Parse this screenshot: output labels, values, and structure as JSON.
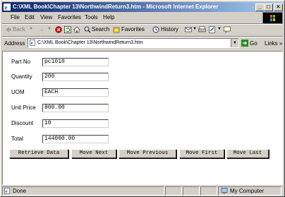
{
  "window": {
    "title": "C:\\XML Book\\Chapter 13\\NorthwindReturn3.htm - Microsoft Internet Explorer",
    "controls": {
      "minimize": "_",
      "maximize": "□",
      "close": "×"
    }
  },
  "menu": [
    "File",
    "Edit",
    "View",
    "Favorites",
    "Tools",
    "Help"
  ],
  "toolbar": {
    "back": "Back",
    "forward": "→",
    "search": "Search",
    "favorites": "Favorites",
    "history": "History"
  },
  "address": {
    "label": "Address",
    "value": "C:\\XML Book\\Chapter 13\\NorthwindReturn3.htm",
    "go": "Go",
    "links": "Links »"
  },
  "form": {
    "fields": [
      {
        "label": "Part No",
        "value": "pc1010"
      },
      {
        "label": "Quantity",
        "value": "200"
      },
      {
        "label": "UOM",
        "value": "EACH"
      },
      {
        "label": "Unit Price",
        "value": "800.00"
      },
      {
        "label": "Discount",
        "value": "10"
      },
      {
        "label": "Total",
        "value": "144000.00"
      }
    ],
    "buttons": [
      "Retrieve Data",
      "Move Next",
      "Move Previous",
      "Move First",
      "Move Last"
    ]
  },
  "status": {
    "left": "Done",
    "zone": "My Computer"
  }
}
